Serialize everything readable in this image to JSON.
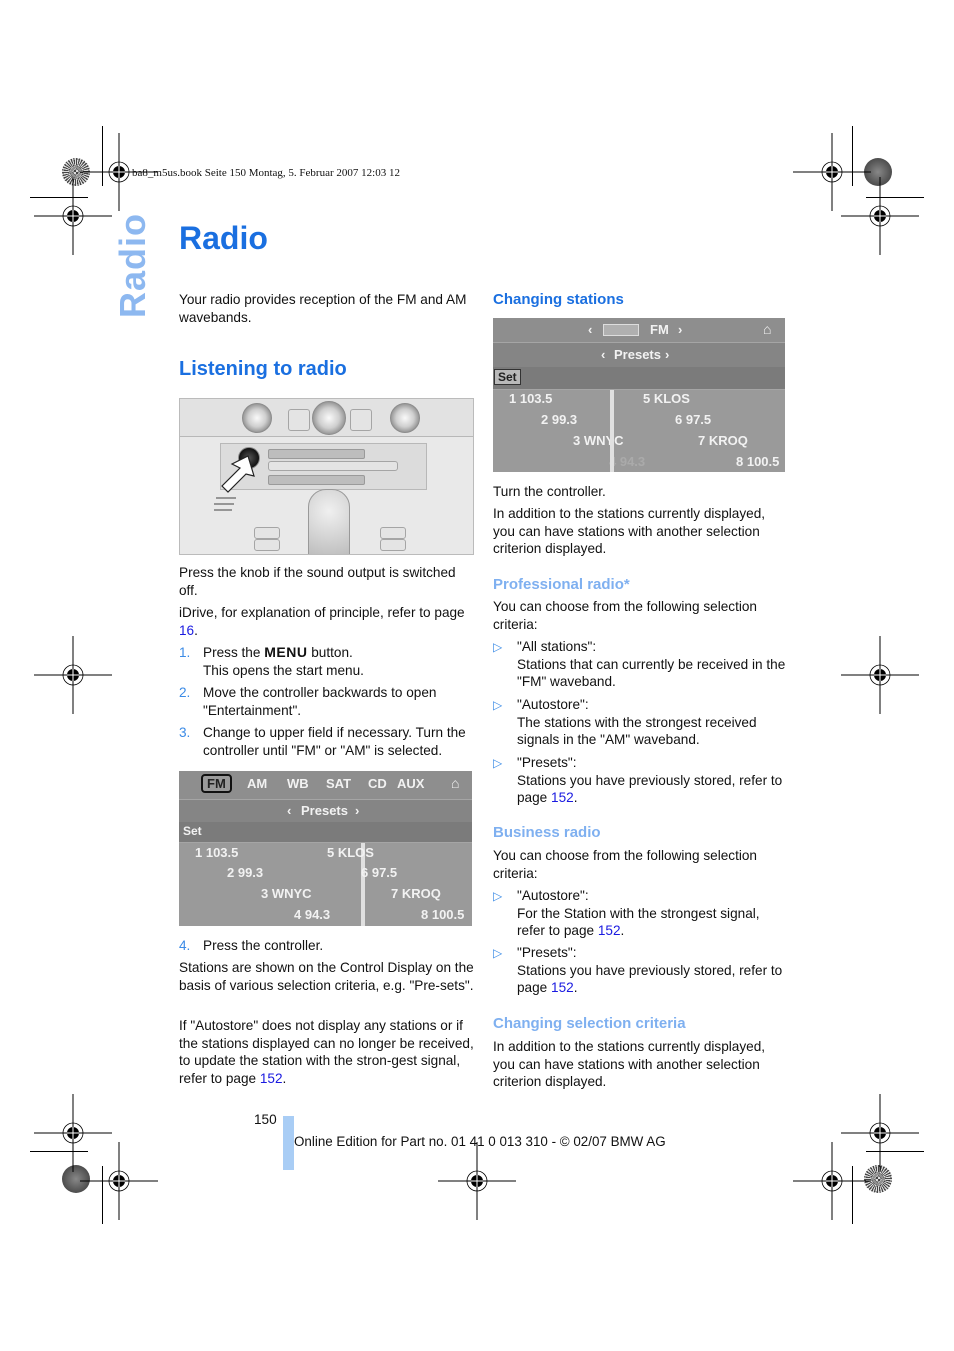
{
  "print_header": "ba8_m5us.book  Seite 150  Montag, 5. Februar 2007  12:03 12",
  "side_tab": "Radio",
  "page_title": "Radio",
  "intro": "Your radio provides reception of the FM and AM wavebands.",
  "left_column": {
    "heading": "Listening to radio",
    "photo_alt": "Radio control knob on center console",
    "press_knob": "Press the knob if the sound output is switched off.",
    "idrive_ref": {
      "text": "iDrive, for explanation of principle, refer to page ",
      "page": "16",
      "end": "."
    },
    "steps": [
      {
        "num": "1.",
        "pre": "Press the ",
        "menu_word": "MENU",
        "post": " button.",
        "line2": "This opens the start menu."
      },
      {
        "num": "2.",
        "text": "Move the controller backwards to open \"Entertainment\"."
      },
      {
        "num": "3.",
        "text": "Change to upper field if necessary. Turn the controller until \"FM\" or \"AM\" is selected."
      },
      {
        "num": "4.",
        "text": "Press the controller."
      }
    ],
    "stations_shown": "Stations are shown on the Control Display on the basis of various selection criteria, e.g. \"Pre-sets\".",
    "autostore_note": {
      "text": "If \"Autostore\" does not display any stations or if the stations displayed can no longer be received, to update the station with the stron-gest signal, refer to page ",
      "page": "152",
      "end": "."
    }
  },
  "screen_left": {
    "tabs": [
      "FM",
      "AM",
      "WB",
      "SAT",
      "CD",
      "AUX"
    ],
    "selected_tab": "FM",
    "selector": "Presets",
    "set_label": "Set",
    "stations_left": [
      "1 103.5",
      "2 99.3",
      "3 WNYC",
      "4 94.3"
    ],
    "stations_right": [
      "5 KLOS",
      "6 97.5",
      "7 KROQ",
      "8 100.5"
    ]
  },
  "right_column": {
    "heading_changing": "Changing stations",
    "turn": "Turn the controller.",
    "in_addition": "In addition to the stations currently displayed, you can have stations with another selection criterion displayed.",
    "professional": {
      "heading": "Professional radio*",
      "intro": "You can choose from the following selection criteria:",
      "items": [
        {
          "title": "\"All stations\":",
          "desc": "Stations that can currently be received in the \"FM\" waveband."
        },
        {
          "title": "\"Autostore\":",
          "desc": "The stations with the strongest received signals in the \"AM\" waveband."
        },
        {
          "title": "\"Presets\":",
          "desc": "Stations you have previously stored, refer to page ",
          "page": "152"
        }
      ]
    },
    "business": {
      "heading": "Business radio",
      "intro": "You can choose from the following selection criteria:",
      "items": [
        {
          "title": "\"Autostore\":",
          "desc": "For the Station with the strongest signal, refer to page ",
          "page": "152"
        },
        {
          "title": "\"Presets\":",
          "desc": "Stations you have previously stored, refer to page ",
          "page": "152"
        }
      ]
    },
    "changing_criteria": {
      "heading": "Changing selection criteria",
      "text": "In addition to the stations currently displayed, you can have stations with another selection criterion displayed."
    }
  },
  "screen_right": {
    "band": "FM",
    "selector": "Presets",
    "set_label": "Set",
    "stations_left": [
      "1 103.5",
      "2 99.3",
      "3 WNYC",
      "4 94.3"
    ],
    "stations_right": [
      "5 KLOS",
      "6 97.5",
      "7 KROQ",
      "8 100.5"
    ]
  },
  "footer": {
    "page_number": "150",
    "edition": "Online Edition for Part no. 01 41 0 013 310 - © 02/07 BMW AG"
  },
  "colors": {
    "heading_blue": "#1a6fe0",
    "light_blue": "#7fb0f0",
    "link_blue": "#1a1ae0",
    "bar_blue": "#a9cdf5"
  }
}
